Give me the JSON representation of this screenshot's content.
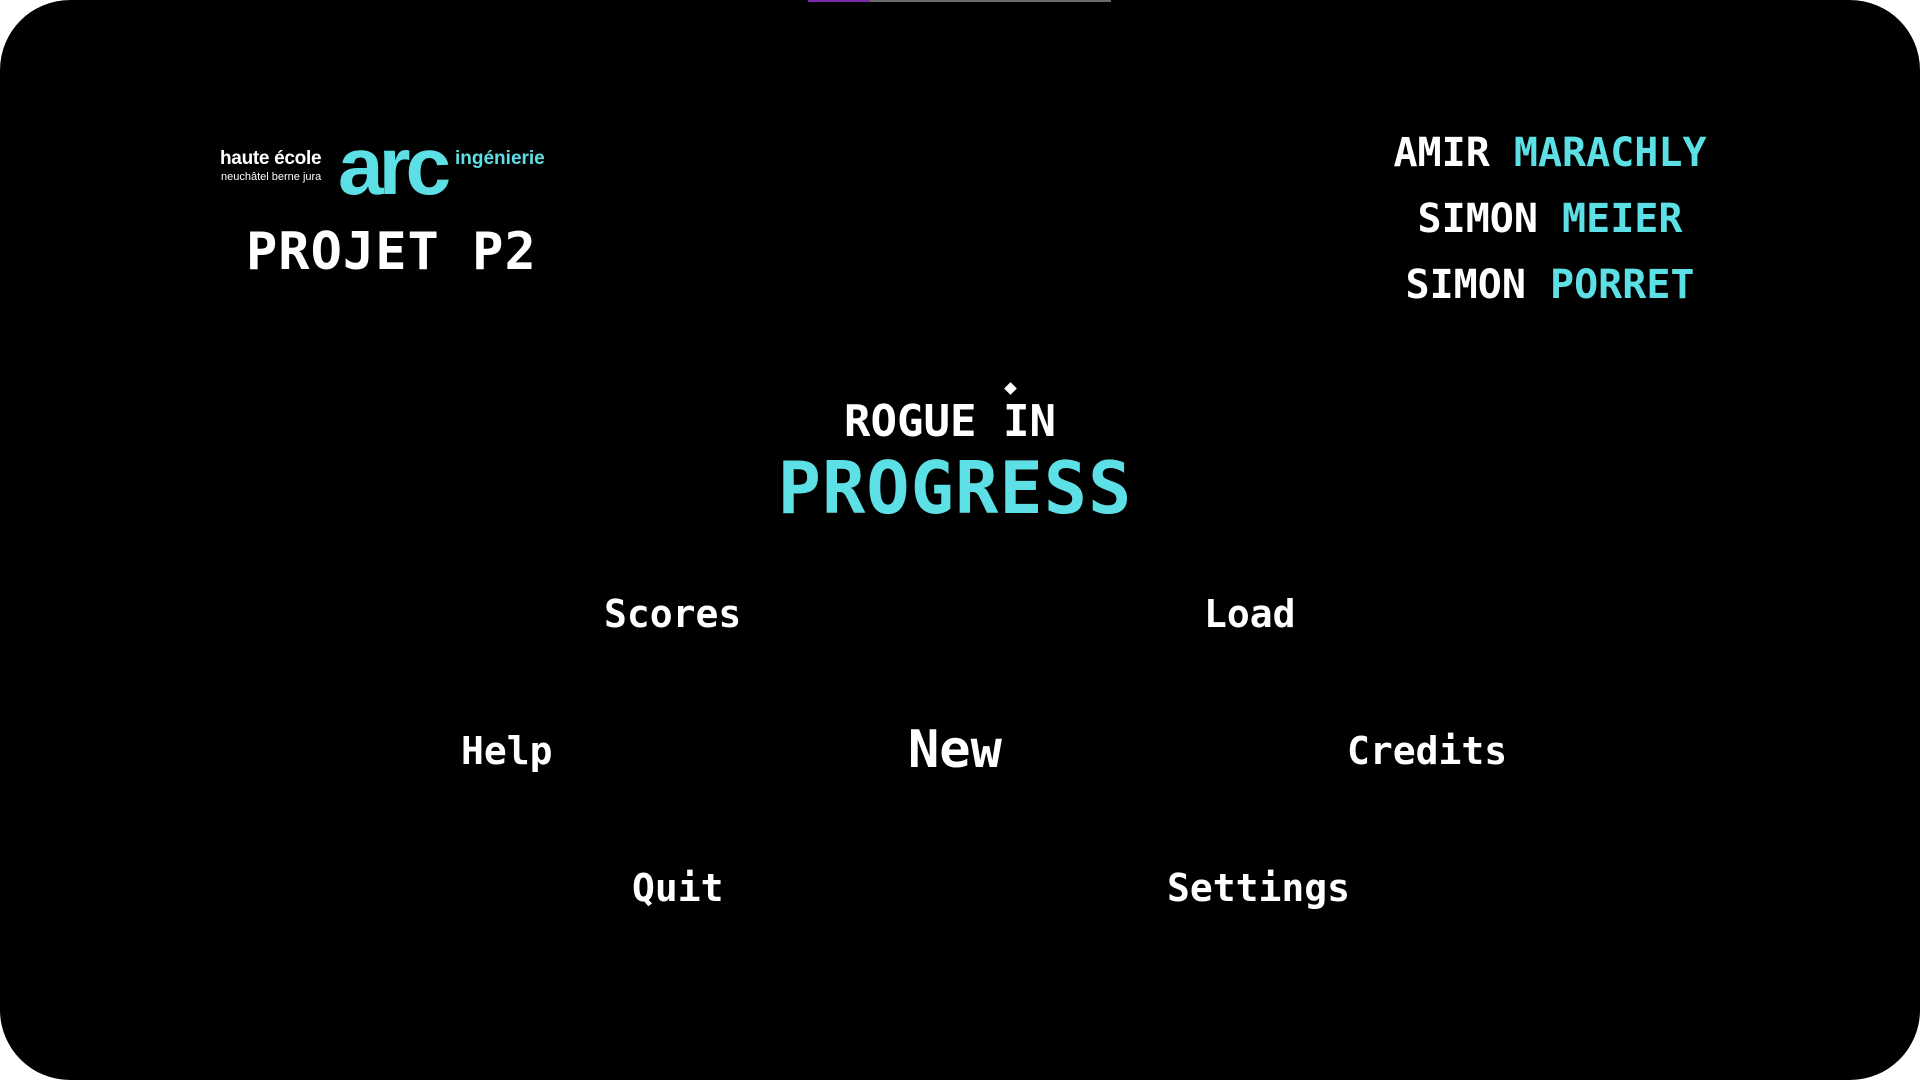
{
  "logo": {
    "line1": "haute école",
    "line2": "neuchâtel berne jura",
    "brand": "arc",
    "department": "ingénierie"
  },
  "project_title": "PROJET P2",
  "authors": [
    {
      "first": "AMIR",
      "last": "MARACHLY"
    },
    {
      "first": "SIMON",
      "last": "MEIER"
    },
    {
      "first": "SIMON",
      "last": "PORRET"
    }
  ],
  "game_title": {
    "line1": "ROGUE IN",
    "line2": "PROGRESS"
  },
  "menu": {
    "scores": "Scores",
    "load": "Load",
    "help": "Help",
    "new": "New",
    "credits": "Credits",
    "quit": "Quit",
    "settings": "Settings"
  },
  "colors": {
    "background": "#000000",
    "accent": "#5ce0e6",
    "text": "#ffffff"
  }
}
